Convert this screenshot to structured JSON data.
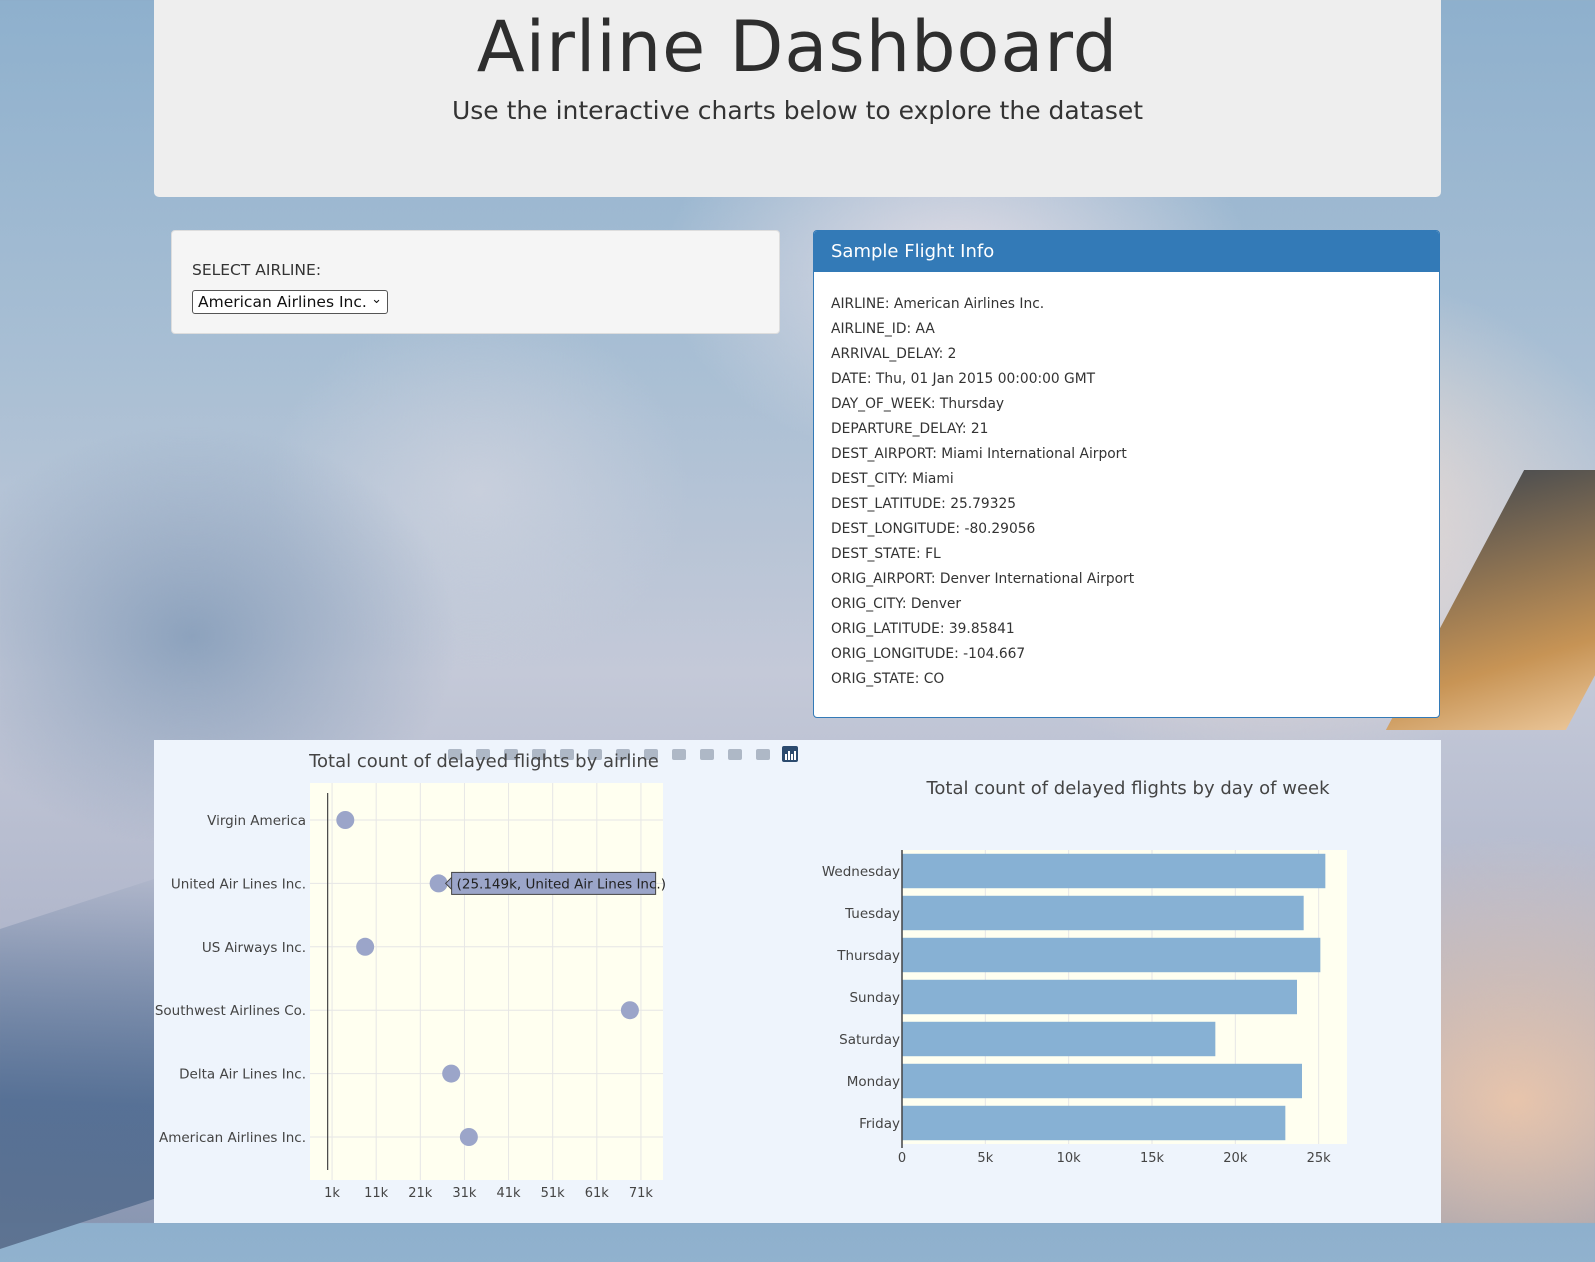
{
  "header": {
    "title": "Airline Dashboard",
    "subtitle": "Use the interactive charts below to explore the dataset"
  },
  "selector": {
    "label": "SELECT AIRLINE:",
    "selected": "American Airlines Inc."
  },
  "info_panel": {
    "title": "Sample Flight Info",
    "lines": [
      "AIRLINE: American Airlines Inc.",
      "AIRLINE_ID: AA",
      "ARRIVAL_DELAY: 2",
      "DATE: Thu, 01 Jan 2015 00:00:00 GMT",
      "DAY_OF_WEEK: Thursday",
      "DEPARTURE_DELAY: 21",
      "DEST_AIRPORT: Miami International Airport",
      "DEST_CITY: Miami",
      "DEST_LATITUDE: 25.79325",
      "DEST_LONGITUDE: -80.29056",
      "DEST_STATE: FL",
      "ORIG_AIRPORT: Denver International Airport",
      "ORIG_CITY: Denver",
      "ORIG_LATITUDE: 39.85841",
      "ORIG_LONGITUDE: -104.667",
      "ORIG_STATE: CO"
    ]
  },
  "toolbar": {
    "icons": [
      "camera-icon",
      "zoom-icon",
      "pan-icon",
      "box-select-icon",
      "lasso-select-icon",
      "zoom-in-icon",
      "zoom-out-icon",
      "autoscale-icon",
      "reset-axes-icon",
      "spike-lines-icon",
      "hover-closest-icon",
      "hover-compare-icon",
      "plotly-logo-icon"
    ]
  },
  "chart_data": [
    {
      "type": "scatter",
      "title": "Total count of delayed flights by airline",
      "categories": [
        "American Airlines Inc.",
        "Delta Air Lines Inc.",
        "Southwest Airlines Co.",
        "US Airways Inc.",
        "United Air Lines Inc.",
        "Virgin America"
      ],
      "values": [
        32000,
        28000,
        68500,
        8500,
        25149,
        4000
      ],
      "xticks": [
        "1k",
        "11k",
        "21k",
        "31k",
        "41k",
        "51k",
        "61k",
        "71k"
      ],
      "xtick_values": [
        1000,
        11000,
        21000,
        31000,
        41000,
        51000,
        61000,
        71000
      ],
      "xlim": [
        -4000,
        76000
      ],
      "grid": true,
      "colors": {
        "marker": "#9ba5c9",
        "plot_bg": "#fffff0",
        "grid": "#e6e6e6"
      },
      "tooltip": "(25.149k, United Air Lines Inc.)"
    },
    {
      "type": "bar",
      "title": "Total count of delayed flights by day of week",
      "categories": [
        "Friday",
        "Monday",
        "Saturday",
        "Sunday",
        "Thursday",
        "Tuesday",
        "Wednesday"
      ],
      "values": [
        23000,
        24000,
        18800,
        23700,
        25100,
        24100,
        25400
      ],
      "xticks": [
        "0",
        "5k",
        "10k",
        "15k",
        "20k",
        "25k"
      ],
      "xtick_values": [
        0,
        5000,
        10000,
        15000,
        20000,
        25000
      ],
      "xlim": [
        0,
        26700
      ],
      "orientation": "horizontal",
      "grid": true,
      "colors": {
        "bar": "#87b1d4",
        "plot_bg": "#fffff0"
      }
    }
  ]
}
